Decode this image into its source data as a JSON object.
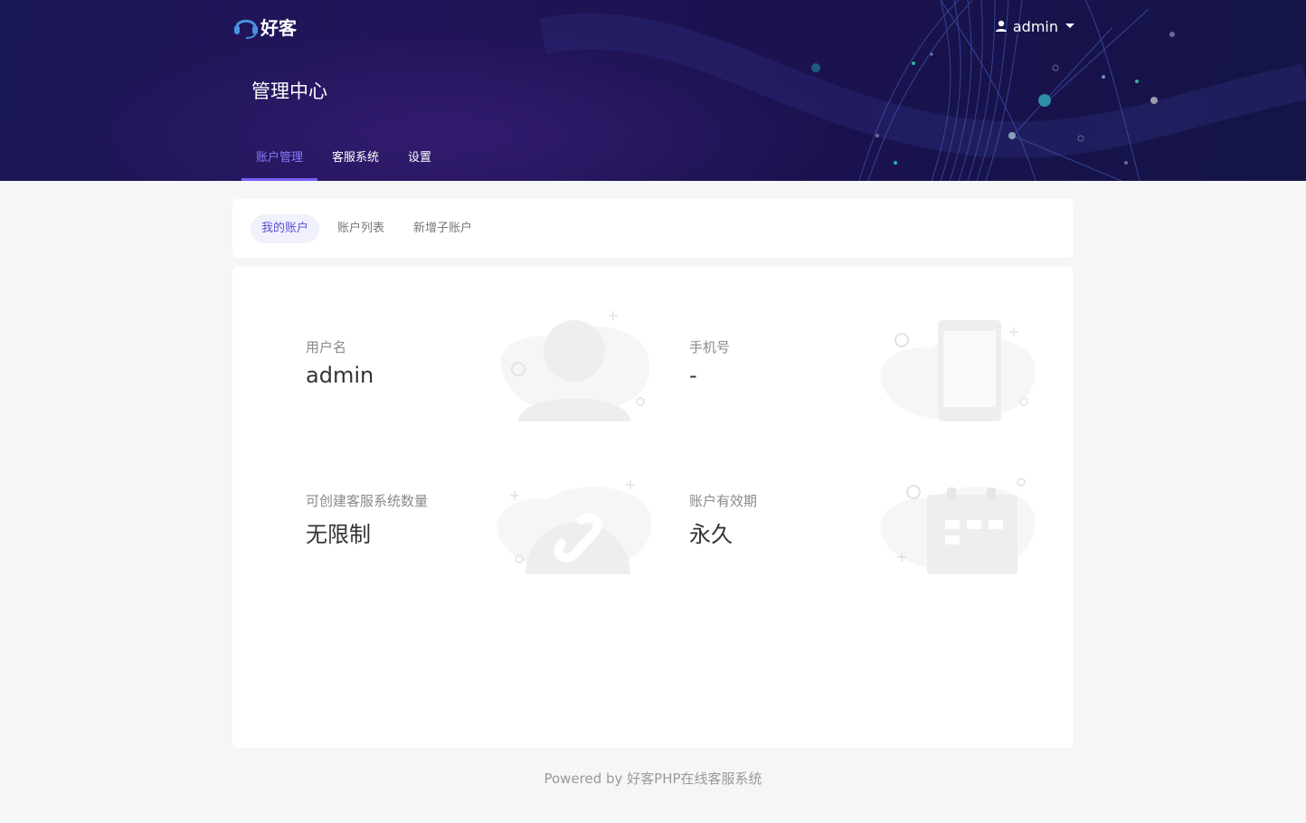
{
  "header": {
    "logo_text": "好客",
    "user_name": "admin",
    "page_title": "管理中心"
  },
  "main_tabs": [
    {
      "label": "账户管理",
      "active": true
    },
    {
      "label": "客服系统",
      "active": false
    },
    {
      "label": "设置",
      "active": false
    }
  ],
  "sub_tabs": [
    {
      "label": "我的账户",
      "active": true
    },
    {
      "label": "账户列表",
      "active": false
    },
    {
      "label": "新增子账户",
      "active": false
    }
  ],
  "account_info": {
    "username": {
      "label": "用户名",
      "value": "admin",
      "icon": "user-icon"
    },
    "phone": {
      "label": "手机号",
      "value": "-",
      "icon": "phone-icon"
    },
    "service_quota": {
      "label": "可创建客服系统数量",
      "value": "无限制",
      "icon": "link-icon"
    },
    "validity": {
      "label": "账户有效期",
      "value": "永久",
      "icon": "calendar-icon"
    }
  },
  "footer": {
    "text": "Powered by 好客PHP在线客服系统"
  },
  "colors": {
    "banner": "#1c1454",
    "accent": "#7b5cff",
    "active_subtab_bg": "#f0f1fb",
    "page_bg": "#f5f6f8"
  }
}
